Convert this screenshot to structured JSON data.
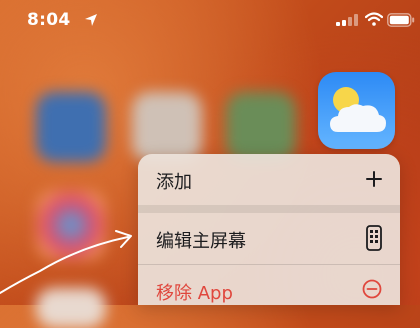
{
  "status_bar": {
    "time": "8:04"
  },
  "context_menu": {
    "items": [
      {
        "label": "添加",
        "icon": "plus-icon",
        "style": "normal"
      },
      {
        "label": "编辑主屏幕",
        "icon": "iphone-apps-icon",
        "style": "normal"
      },
      {
        "label": "移除 App",
        "icon": "minus-circle-icon",
        "style": "destructive"
      }
    ]
  },
  "colors": {
    "destructive": "#e0473d",
    "weather_icon_top": "#2d8af5",
    "weather_icon_bottom": "#64b5ff",
    "menu_background": "#ece2da"
  }
}
